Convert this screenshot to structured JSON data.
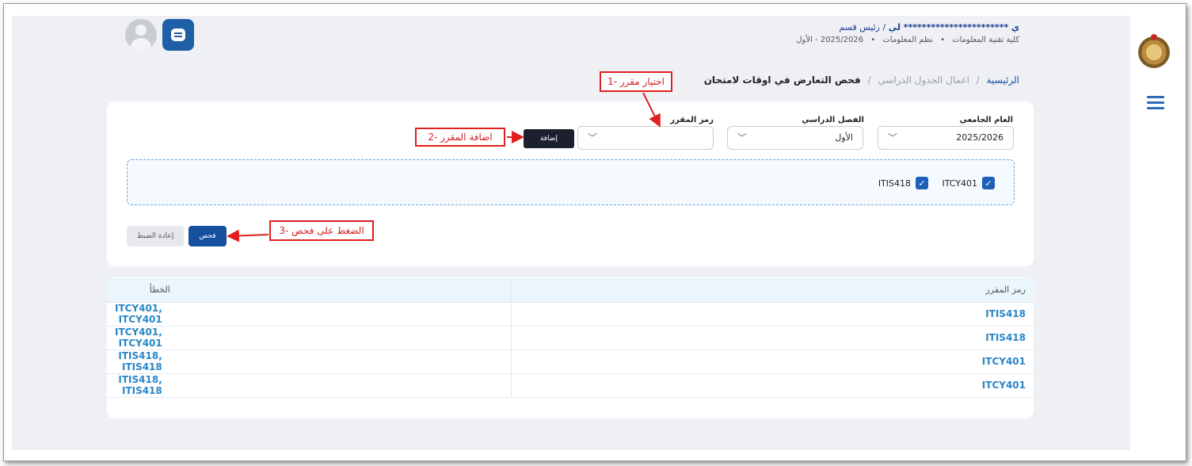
{
  "header": {
    "user_name": "ي *********************** لي",
    "user_role": "/ رئيس قسم",
    "college": "كلية تقنية المعلومات",
    "department": "نظم المعلومات",
    "term": "2025/2026 - الأول"
  },
  "breadcrumb": {
    "home": "الرئيسية",
    "section": "اعمال الجدول الدراسي",
    "current": "فحص التعارض في اوقات لامتحان",
    "separator": "/"
  },
  "form": {
    "year_label": "العام الجامعي",
    "year_value": "2025/2026",
    "semester_label": "الفصل الدراسي",
    "semester_value": "الأول",
    "course_label": "رمز المقرر",
    "course_value": "",
    "add_button": "إضافة",
    "check_button": "فحص",
    "reset_button": "إعادة الضبط"
  },
  "selected_courses": [
    {
      "code": "ITCY401",
      "checked": true
    },
    {
      "code": "ITIS418",
      "checked": true
    }
  ],
  "annotations": {
    "step1": "اختيار مقرر -1",
    "step2": "اضافة المقرر -2",
    "step3": "الضغط على فحص -3"
  },
  "results": {
    "col_course": "رمز المقرر",
    "col_error": "الخطأ",
    "rows": [
      {
        "course": "ITIS418",
        "error": "ITCY401, ITCY401"
      },
      {
        "course": "ITIS418",
        "error": "ITCY401, ITCY401"
      },
      {
        "course": "ITCY401",
        "error": "ITIS418, ITIS418"
      },
      {
        "course": "ITCY401",
        "error": "ITIS418, ITIS418"
      }
    ]
  },
  "icons": {
    "chevron": "chevron-down-icon",
    "check": "check-icon",
    "menu": "hamburger-menu-icon",
    "chat": "chat-bubble-icon"
  },
  "colors": {
    "primary": "#15509c",
    "dark_button": "#1b1f2e",
    "annotation": "#e0201f",
    "link_blue": "#2a86c8",
    "page_bg": "#eef0f4"
  }
}
